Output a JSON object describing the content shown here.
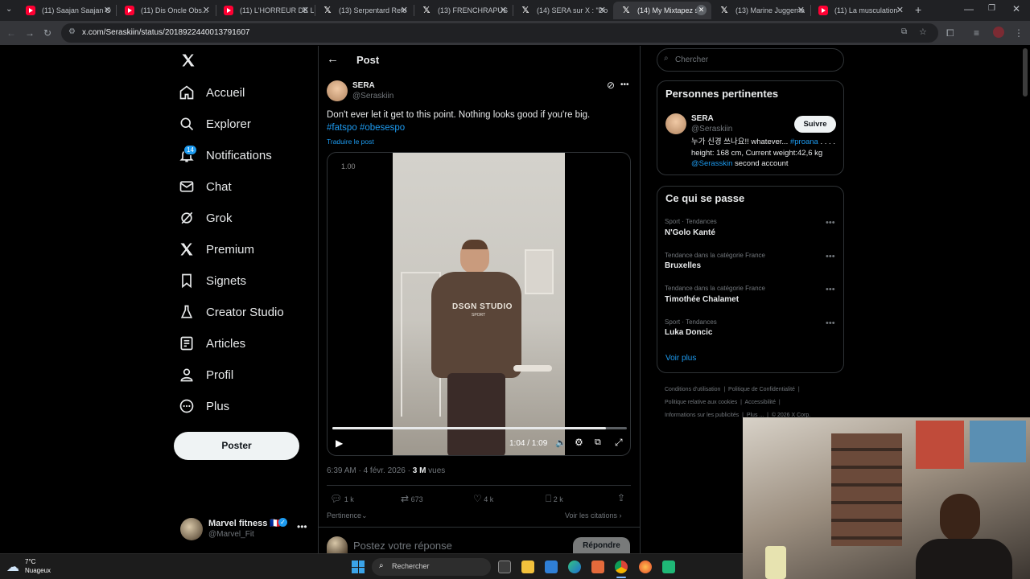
{
  "browser": {
    "tabs": [
      {
        "title": "(11) Saajan Saajan O",
        "icon": "youtube-icon"
      },
      {
        "title": "(11) Dis Oncle Obs...",
        "icon": "youtube-icon"
      },
      {
        "title": "(11) L'HORREUR DE L",
        "icon": "youtube-icon"
      },
      {
        "title": "(13) Serpentard Refo",
        "icon": "x-icon"
      },
      {
        "title": "(13) FRENCHRAPUS",
        "icon": "x-icon"
      },
      {
        "title": "(14) SERA sur X : \"Do",
        "icon": "x-icon"
      },
      {
        "title": "(14) My Mixtapez sur",
        "icon": "x-icon"
      },
      {
        "title": "(13) Marine Juggerna",
        "icon": "x-icon"
      },
      {
        "title": "(11) La musculation",
        "icon": "youtube-icon"
      }
    ],
    "url": "x.com/Seraskiin/status/2018922440013791607"
  },
  "nav": {
    "items": [
      {
        "label": "Accueil",
        "icon": "home-icon"
      },
      {
        "label": "Explorer",
        "icon": "search-icon"
      },
      {
        "label": "Notifications",
        "icon": "bell-icon"
      },
      {
        "label": "Chat",
        "icon": "mail-icon"
      },
      {
        "label": "Grok",
        "icon": "grok-icon"
      },
      {
        "label": "Premium",
        "icon": "x-icon"
      },
      {
        "label": "Signets",
        "icon": "bookmark-icon"
      },
      {
        "label": "Creator Studio",
        "icon": "flask-icon"
      },
      {
        "label": "Articles",
        "icon": "article-icon"
      },
      {
        "label": "Profil",
        "icon": "person-icon"
      },
      {
        "label": "Plus",
        "icon": "more-circle-icon"
      }
    ],
    "notif_badge": "14",
    "post_button": "Poster",
    "account": {
      "name": "Marvel fitness 🇫🇷",
      "handle": "@Marvel_Fit"
    }
  },
  "post": {
    "header": "Post",
    "author": {
      "name": "SERA",
      "handle": "@Seraskiin"
    },
    "text": "Don't ever let it get to this point. Nothing looks good if you're big.",
    "hashtags": [
      "#fatspo",
      "#obesespo"
    ],
    "translate": "Traduire le post",
    "video": {
      "speed": "1.00",
      "time": "1:04 / 1:09",
      "progress": 0.93,
      "hoodie_text": "DSGN STUDIO",
      "hoodie_sub": "SPORT"
    },
    "meta": {
      "time": "6:39 AM · 4 févr. 2026 · ",
      "views_count": "3 M",
      "views_label": " vues"
    },
    "actions": {
      "replies": "1 k",
      "reposts": "673",
      "likes": "4 k",
      "bookmarks": "2 k"
    },
    "sort_label": "Pertinence",
    "quotes_link": "Voir les citations",
    "reply_placeholder": "Postez votre réponse",
    "reply_button": "Répondre"
  },
  "sidebar": {
    "search_placeholder": "Chercher",
    "relevant": {
      "title": "Personnes pertinentes",
      "name": "SERA",
      "handle": "@Seraskiin",
      "follow": "Suivre",
      "bio_start": "누가 신경 쓰나요!! whatever... ",
      "bio_tag": "#proana",
      "bio_mid": " . . . . height: 168 cm, Current weight:42,6 kg ",
      "bio_link": "@Serasskin",
      "bio_end": " second account"
    },
    "trends_title": "Ce qui se passe",
    "trends": [
      {
        "category": "Sport · Tendances",
        "name": "N'Golo Kanté"
      },
      {
        "category": "Tendance dans la catégorie France",
        "name": "Bruxelles"
      },
      {
        "category": "Tendance dans la catégorie France",
        "name": "Timothée Chalamet"
      },
      {
        "category": "Sport · Tendances",
        "name": "Luka Doncic"
      }
    ],
    "see_more": "Voir plus",
    "footer": {
      "l1a": "Conditions d'utilisation",
      "l1b": "Politique de Confidentialité",
      "l2a": "Politique relative aux cookies",
      "l2b": "Accessibilité",
      "l3a": "Informations sur les publicités",
      "l3b": "Plus ...",
      "l3c": "© 2026 X Corp."
    }
  },
  "taskbar": {
    "weather_temp": "7°C",
    "weather_desc": "Nuageux",
    "search_label": "Rechercher"
  },
  "colors": {
    "accent": "#1d9bf0",
    "background": "#000000",
    "border": "#2f3336",
    "muted": "#71767b"
  }
}
